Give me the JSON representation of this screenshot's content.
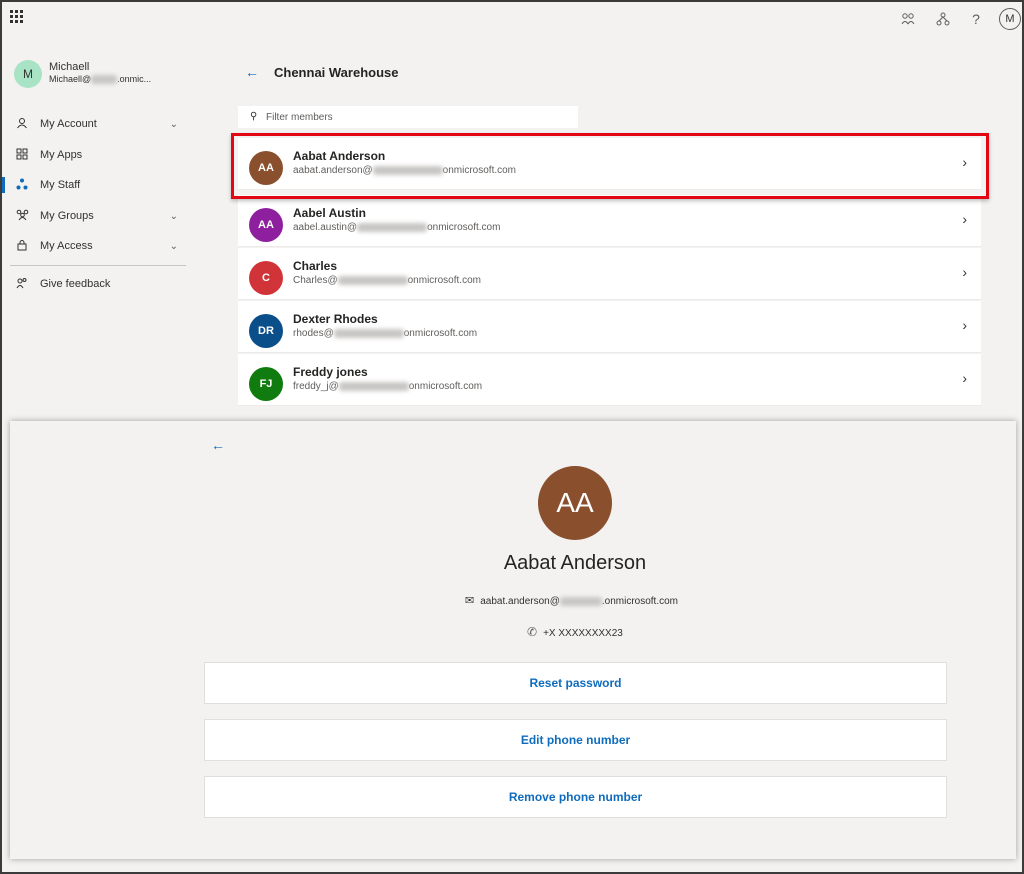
{
  "topbar": {
    "icons": [
      "waffle-icon",
      "org-icon",
      "network-icon",
      "help-icon"
    ],
    "help_glyph": "?",
    "user_initial": "M"
  },
  "user": {
    "initial": "M",
    "name": "Michaell",
    "email_prefix": "Michaell@",
    "email_suffix": ".onmic..."
  },
  "nav": {
    "items": [
      {
        "label": "My Account",
        "icon": "person-icon",
        "has_chevron": true
      },
      {
        "label": "My Apps",
        "icon": "apps-icon",
        "has_chevron": false
      },
      {
        "label": "My Staff",
        "icon": "staff-icon",
        "has_chevron": false,
        "active": true
      },
      {
        "label": "My Groups",
        "icon": "groups-icon",
        "has_chevron": true
      },
      {
        "label": "My Access",
        "icon": "lock-icon",
        "has_chevron": true
      }
    ],
    "feedback_label": "Give feedback"
  },
  "main": {
    "title": "Chennai Warehouse",
    "filter_placeholder": "Filter members",
    "members": [
      {
        "initials": "AA",
        "name": "Aabat Anderson",
        "email_prefix": "aabat.anderson@",
        "email_suffix": "onmicrosoft.com",
        "color": "#8a4f2d"
      },
      {
        "initials": "AA",
        "name": "Aabel Austin",
        "email_prefix": "aabel.austin@",
        "email_suffix": "onmicrosoft.com",
        "color": "#8e1f9e"
      },
      {
        "initials": "C",
        "name": "Charles",
        "email_prefix": "Charles@",
        "email_suffix": "onmicrosoft.com",
        "color": "#d13438"
      },
      {
        "initials": "DR",
        "name": "Dexter Rhodes",
        "email_prefix": "rhodes@",
        "email_suffix": "onmicrosoft.com",
        "color": "#0b4f8a"
      },
      {
        "initials": "FJ",
        "name": "Freddy jones",
        "email_prefix": "freddy_j@",
        "email_suffix": "onmicrosoft.com",
        "color": "#107c10"
      }
    ]
  },
  "detail": {
    "initials": "AA",
    "name": "Aabat Anderson",
    "email_prefix": "aabat.anderson@",
    "email_suffix": ".onmicrosoft.com",
    "phone": "+X XXXXXXXX23",
    "actions": [
      "Reset password",
      "Edit phone number",
      "Remove phone number"
    ]
  },
  "colors": {
    "accent": "#0f6cbd",
    "highlight": "#e30613",
    "background": "#f3f2f1"
  }
}
